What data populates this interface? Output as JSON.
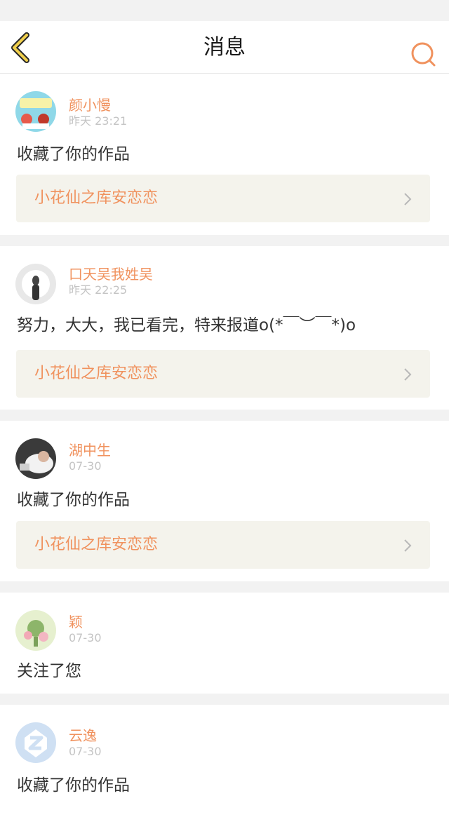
{
  "header": {
    "title": "消息",
    "back_icon": "chevron-left-icon",
    "search_icon": "search-icon"
  },
  "colors": {
    "accent": "#f0925e",
    "work_bg": "#f4f3ec",
    "back_icon_fill": "#f1d04c"
  },
  "messages": [
    {
      "user": "颜小慢",
      "time": "昨天 23:21",
      "text": "收藏了你的作品",
      "work": "小花仙之库安恋恋"
    },
    {
      "user": "口天吴我姓吴",
      "time": "昨天 22:25",
      "text": "努力，大大，我已看完，特来报道o(*￣︶￣*)o",
      "work": "小花仙之库安恋恋"
    },
    {
      "user": "湖中生",
      "time": "07-30",
      "text": "收藏了你的作品",
      "work": "小花仙之库安恋恋"
    },
    {
      "user": "颖",
      "time": "07-30",
      "text": "关注了您"
    },
    {
      "user": "云逸",
      "time": "07-30",
      "text": "收藏了你的作品"
    }
  ]
}
